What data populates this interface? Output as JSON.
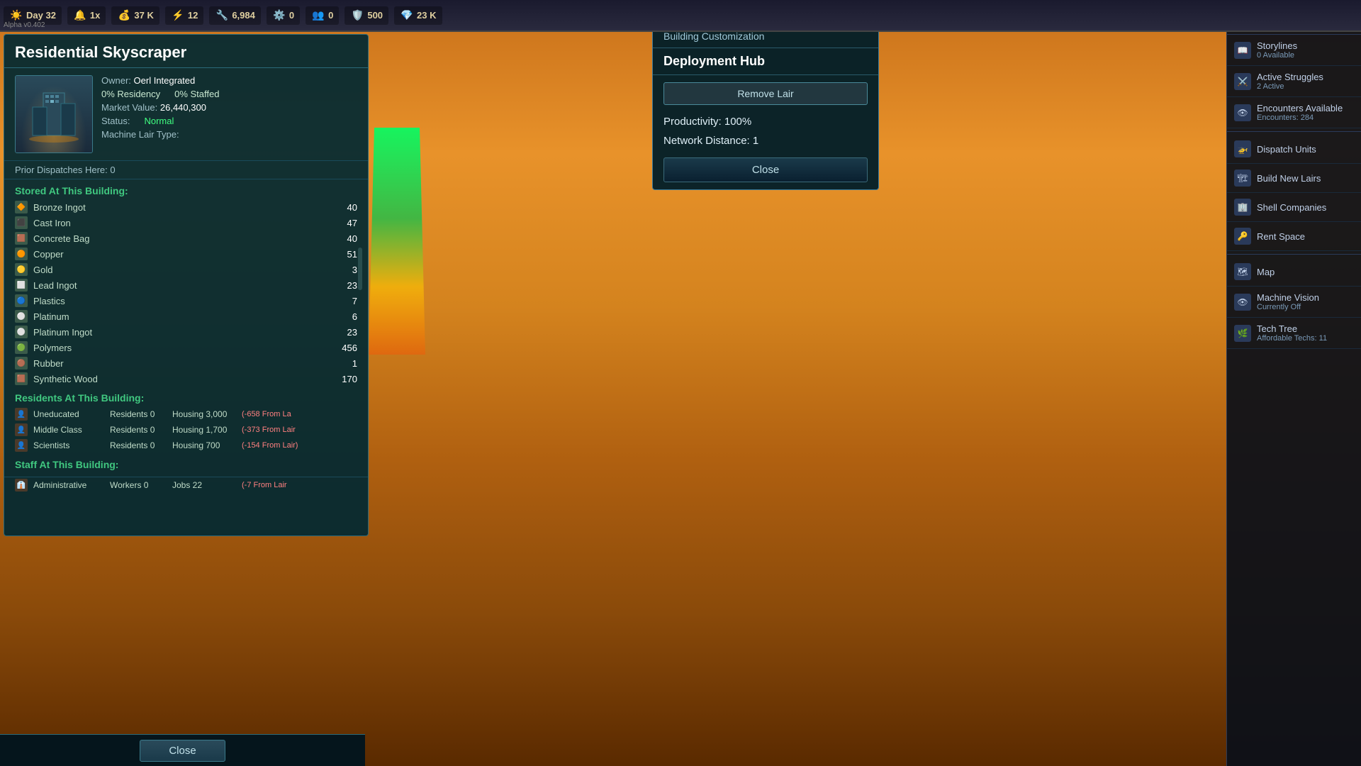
{
  "topbar": {
    "day": "Day 32",
    "speed": "1x",
    "resource1": "37 K",
    "resource2": "12",
    "resource3": "6,984",
    "resource4": "0",
    "resource5": "0",
    "resource6": "500",
    "resource7": "23 K"
  },
  "alpha": "Alpha v0.402",
  "building_panel": {
    "title": "Residential Skyscraper",
    "owner_label": "Owner:",
    "owner_value": "Oerl Integrated",
    "residency": "0% Residency",
    "staffed": "0% Staffed",
    "market_label": "Market Value:",
    "market_value": "26,440,300",
    "status_label": "Status:",
    "status_value": "Normal",
    "lair_type_label": "Machine Lair Type:",
    "lair_type_value": "",
    "prior_dispatch_label": "Prior Dispatches Here:",
    "prior_dispatch_value": "0",
    "stored_title": "Stored At This Building:",
    "inventory": [
      {
        "name": "Bronze Ingot",
        "qty": "40",
        "icon": "🔶"
      },
      {
        "name": "Cast Iron",
        "qty": "47",
        "icon": "⬛"
      },
      {
        "name": "Concrete Bag",
        "qty": "40",
        "icon": "🟫"
      },
      {
        "name": "Copper",
        "qty": "51",
        "icon": "🟠"
      },
      {
        "name": "Gold",
        "qty": "3",
        "icon": "🟡"
      },
      {
        "name": "Lead Ingot",
        "qty": "23",
        "icon": "⬜"
      },
      {
        "name": "Plastics",
        "qty": "7",
        "icon": "🔵"
      },
      {
        "name": "Platinum",
        "qty": "6",
        "icon": "⚪"
      },
      {
        "name": "Platinum Ingot",
        "qty": "23",
        "icon": "⚪"
      },
      {
        "name": "Polymers",
        "qty": "456",
        "icon": "🟢"
      },
      {
        "name": "Rubber",
        "qty": "1",
        "icon": "🟤"
      },
      {
        "name": "Synthetic Wood",
        "qty": "170",
        "icon": "🟫"
      }
    ],
    "residents_title": "Residents At This Building:",
    "residents": [
      {
        "type": "Uneducated",
        "residents_label": "Residents",
        "count": "0",
        "housing_label": "Housing",
        "housing": "3,000",
        "modifier": "(-658 From La"
      },
      {
        "type": "Middle Class",
        "residents_label": "Residents",
        "count": "0",
        "housing_label": "Housing",
        "housing": "1,700",
        "modifier": "(-373 From Lair"
      },
      {
        "type": "Scientists",
        "residents_label": "Residents",
        "count": "0",
        "housing_label": "Housing",
        "housing": "700",
        "modifier": "(-154 From Lair)"
      }
    ],
    "staff_title": "Staff At This Building:",
    "staff": [
      {
        "type": "Administrative",
        "workers_label": "Workers",
        "count": "0",
        "jobs_label": "Jobs",
        "jobs": "22",
        "modifier": "(-7 From Lair"
      }
    ],
    "close_label": "Close"
  },
  "customization_panel": {
    "title": "Building Customization",
    "building_name": "Deployment Hub",
    "remove_lair": "Remove Lair",
    "productivity_label": "Productivity: 100%",
    "network_label": "Network Distance: 1",
    "close_label": "Close"
  },
  "right_sidebar": {
    "items": [
      {
        "label": "Storylines",
        "sublabel": "0 Available",
        "icon": "📖"
      },
      {
        "label": "Active Struggles",
        "sublabel": "2 Active",
        "icon": "⚔️"
      },
      {
        "label": "Encounters Available",
        "sublabel": "Encounters: 284",
        "icon": "👁"
      },
      {
        "label": "Dispatch Units",
        "sublabel": "",
        "icon": "🚁"
      },
      {
        "label": "Build New Lairs",
        "sublabel": "",
        "icon": "🏗"
      },
      {
        "label": "Shell Companies",
        "sublabel": "",
        "icon": "🏢"
      },
      {
        "label": "Rent Space",
        "sublabel": "",
        "icon": "🔑"
      },
      {
        "label": "Map",
        "sublabel": "",
        "icon": "🗺"
      },
      {
        "label": "Machine Vision",
        "sublabel": "Currently Off",
        "icon": "👁"
      },
      {
        "label": "Tech Tree",
        "sublabel": "Affordable Techs: 11",
        "icon": "🌿"
      }
    ]
  }
}
